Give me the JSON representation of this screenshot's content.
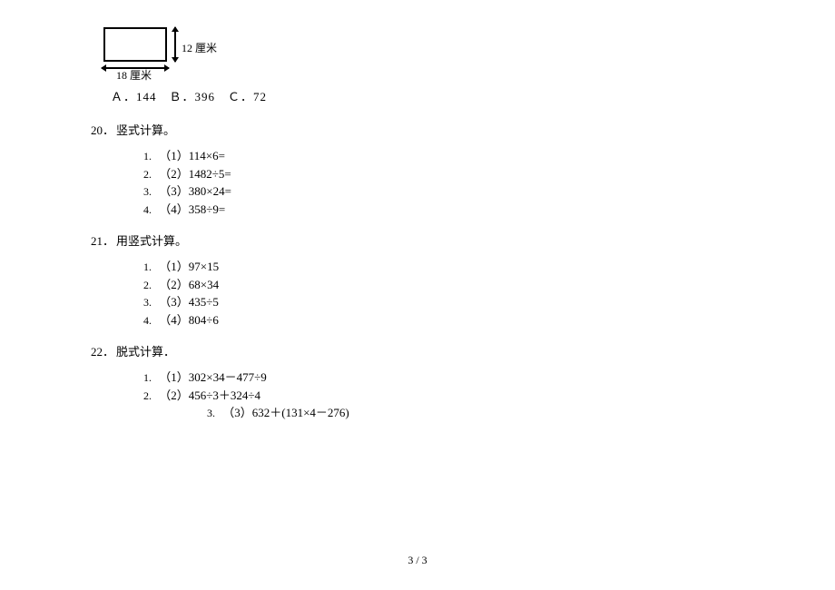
{
  "diagram": {
    "vertical_label": "12 厘米",
    "horizontal_label": "18 厘米"
  },
  "options_line": "Ａ．144　Ｂ．396　Ｃ．72",
  "questions": [
    {
      "number": "20．",
      "title": "竖式计算。",
      "items": [
        {
          "num": "1.",
          "text": "（1）114×6="
        },
        {
          "num": "2.",
          "text": "（2）1482÷5="
        },
        {
          "num": "3.",
          "text": "（3）380×24="
        },
        {
          "num": "4.",
          "text": "（4）358÷9="
        }
      ]
    },
    {
      "number": "21．",
      "title": "用竖式计算。",
      "items": [
        {
          "num": "1.",
          "text": "（1）97×15"
        },
        {
          "num": "2.",
          "text": "（2）68×34"
        },
        {
          "num": "3.",
          "text": "（3）435÷5"
        },
        {
          "num": "4.",
          "text": "（4）804÷6"
        }
      ]
    },
    {
      "number": "22．",
      "title": "脱式计算．",
      "items": [
        {
          "num": "1.",
          "text": "（1）302×34－477÷9"
        },
        {
          "num": "2.",
          "text": "（2）456÷3＋324÷4"
        },
        {
          "num": "3.",
          "text": "（3）632＋(131×4－276)",
          "indented": true
        }
      ]
    }
  ],
  "footer": "3 / 3"
}
